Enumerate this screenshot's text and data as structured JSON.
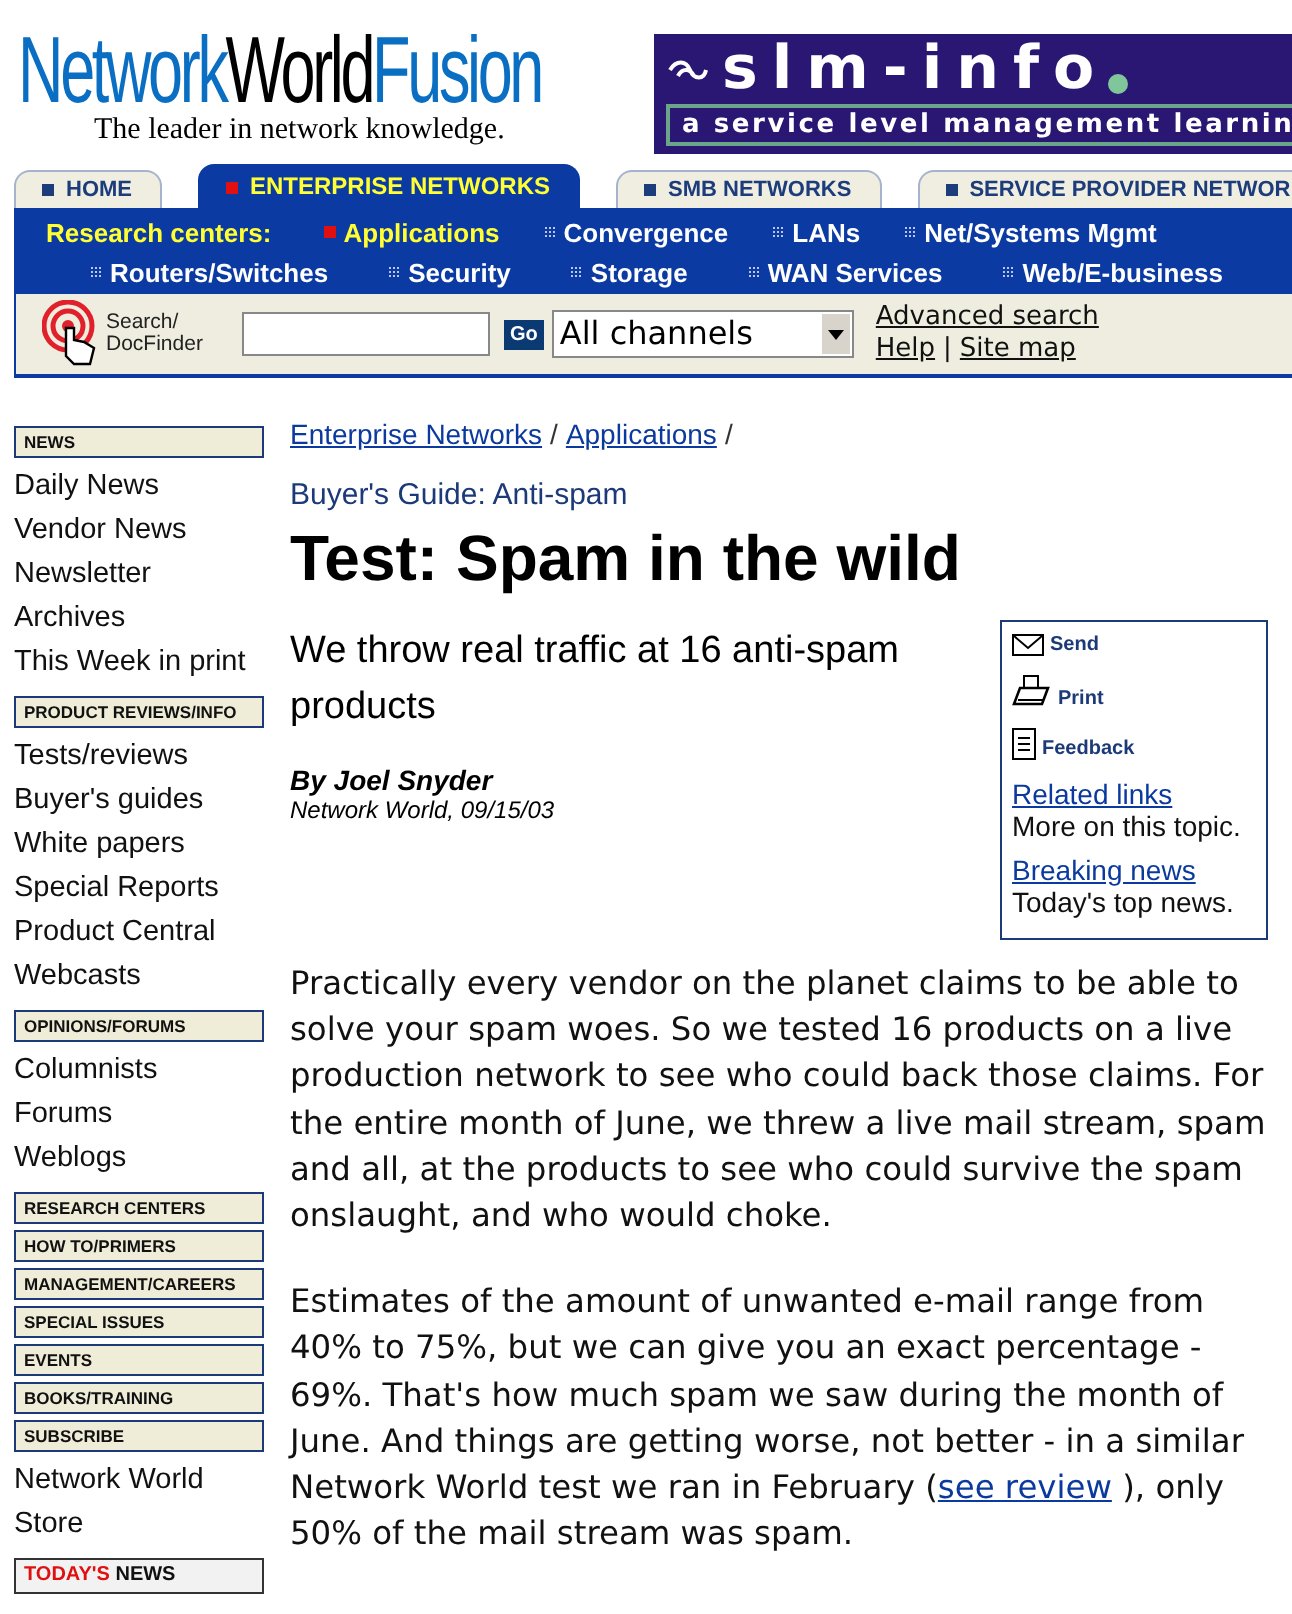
{
  "logo": {
    "parts": [
      {
        "text": "Network",
        "color": "#0a6fc2"
      },
      {
        "text": "World",
        "color": "#000000"
      },
      {
        "text": "Fusion",
        "color": "#0a6fc2"
      }
    ],
    "tagline": "The leader in network knowledge."
  },
  "banner": {
    "title": "slm-info",
    "subtitle": "a service level management learnin"
  },
  "tabs": [
    {
      "label": "HOME",
      "selected": false
    },
    {
      "label": "ENTERPRISE NETWORKS",
      "selected": true
    },
    {
      "label": "SMB NETWORKS",
      "selected": false
    },
    {
      "label": "SERVICE PROVIDER NETWOR",
      "selected": false
    }
  ],
  "research": {
    "rows": [
      [
        {
          "kind": "label",
          "label": "Research centers:"
        },
        {
          "kind": "link",
          "label": "Applications",
          "selected": true
        },
        {
          "kind": "link",
          "label": "Convergence",
          "selected": false
        },
        {
          "kind": "link",
          "label": "LANs",
          "selected": false
        },
        {
          "kind": "link",
          "label": "Net/Systems Mgmt",
          "selected": false
        }
      ],
      [
        {
          "kind": "link",
          "label": "Routers/Switches",
          "selected": false
        },
        {
          "kind": "link",
          "label": "Security",
          "selected": false
        },
        {
          "kind": "link",
          "label": "Storage",
          "selected": false
        },
        {
          "kind": "link",
          "label": "WAN Services",
          "selected": false
        },
        {
          "kind": "link",
          "label": "Web/E-business",
          "selected": false
        }
      ]
    ]
  },
  "search": {
    "label": "Search/ DocFinder",
    "button": "Go",
    "channel": "All channels",
    "advanced": "Advanced search",
    "links": [
      "Help",
      "Site map"
    ],
    "separator": "|"
  },
  "sidebar": [
    {
      "kind": "header",
      "label": "NEWS"
    },
    {
      "kind": "link",
      "label": "Daily News"
    },
    {
      "kind": "link",
      "label": "Vendor News"
    },
    {
      "kind": "link",
      "label": "Newsletter"
    },
    {
      "kind": "link",
      "label": "Archives"
    },
    {
      "kind": "link",
      "label": "This Week in print"
    },
    {
      "kind": "header",
      "label": "PRODUCT REVIEWS/INFO"
    },
    {
      "kind": "link",
      "label": "Tests/reviews"
    },
    {
      "kind": "link",
      "label": "Buyer's guides"
    },
    {
      "kind": "link",
      "label": "White papers"
    },
    {
      "kind": "link",
      "label": "Special Reports"
    },
    {
      "kind": "link",
      "label": "Product Central"
    },
    {
      "kind": "link",
      "label": "Webcasts"
    },
    {
      "kind": "header",
      "label": "OPINIONS/FORUMS"
    },
    {
      "kind": "link",
      "label": "Columnists"
    },
    {
      "kind": "link",
      "label": "Forums"
    },
    {
      "kind": "link",
      "label": "Weblogs"
    },
    {
      "kind": "header",
      "label": "RESEARCH CENTERS"
    },
    {
      "kind": "header",
      "label": "HOW TO/PRIMERS"
    },
    {
      "kind": "header",
      "label": "MANAGEMENT/CAREERS"
    },
    {
      "kind": "header",
      "label": "SPECIAL ISSUES"
    },
    {
      "kind": "header",
      "label": "EVENTS"
    },
    {
      "kind": "header",
      "label": "BOOKS/TRAINING"
    },
    {
      "kind": "header",
      "label": "SUBSCRIBE"
    },
    {
      "kind": "link",
      "label": "Network World"
    },
    {
      "kind": "link",
      "label": "Store"
    },
    {
      "kind": "news",
      "prefix": "TODAY'S",
      "label": "NEWS"
    }
  ],
  "breadcrumb": {
    "items": [
      "Enterprise Networks",
      "Applications"
    ],
    "separator": "/"
  },
  "kicker": "Buyer's Guide: Anti-spam",
  "title": "Test: Spam in the wild",
  "deck": "We throw real traffic at 16 anti-spam products",
  "byline": "By Joel Snyder",
  "source": "Network World, 09/15/03",
  "tools": {
    "actions": [
      {
        "kind": "mail",
        "label": "Send"
      },
      {
        "kind": "print",
        "label": "Print"
      },
      {
        "kind": "doc",
        "label": "Feedback"
      }
    ],
    "links": [
      {
        "link": "Related links",
        "text": "More on this topic."
      },
      {
        "link": "Breaking news",
        "text": "Today's top news."
      }
    ]
  },
  "paragraphs": [
    {
      "text": "Practically every vendor on the planet claims to be able to solve your spam woes. So we tested 16 products on a live production network to see who could back those claims. For the entire month of June, we threw a live mail stream, spam and all, at the products to see who could survive the spam onslaught, and who would choke."
    },
    {
      "text": "Estimates of the amount of unwanted e-mail range from 40% to 75%, but we can give you an exact percentage - 69%. That's how much spam we saw during the month of June. And things are getting worse, not better - in a similar Network World test we ran in February (",
      "link": "see review",
      "after": " ), only 50% of the mail stream was spam."
    }
  ]
}
